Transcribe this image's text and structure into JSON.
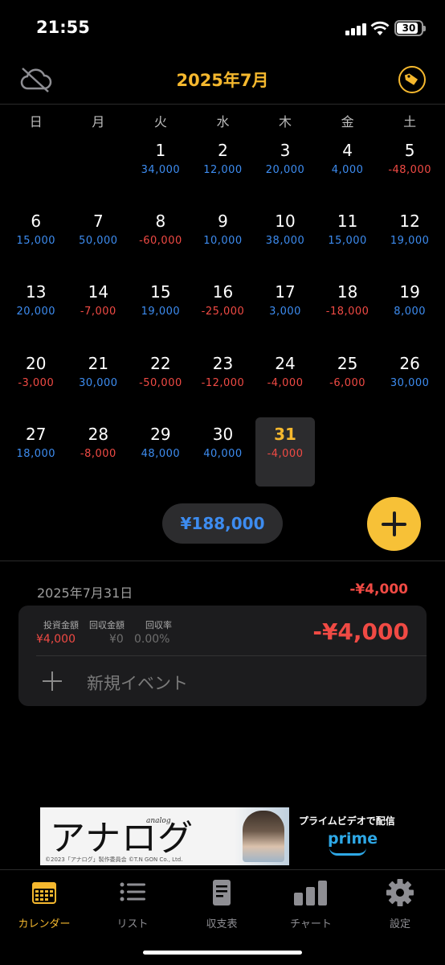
{
  "status_bar": {
    "time": "21:55",
    "battery": "30"
  },
  "header": {
    "title": "2025年7月",
    "cloud_icon": "cloud-off-icon",
    "tag_icon": "tag-icon"
  },
  "weekdays": [
    "日",
    "月",
    "火",
    "水",
    "木",
    "金",
    "土"
  ],
  "calendar": {
    "leading_blank_days": 2,
    "today": 31,
    "days": [
      {
        "day": "1",
        "amount": "34,000",
        "sign": "pos"
      },
      {
        "day": "2",
        "amount": "12,000",
        "sign": "pos"
      },
      {
        "day": "3",
        "amount": "20,000",
        "sign": "pos"
      },
      {
        "day": "4",
        "amount": "4,000",
        "sign": "pos"
      },
      {
        "day": "5",
        "amount": "-48,000",
        "sign": "neg"
      },
      {
        "day": "6",
        "amount": "15,000",
        "sign": "pos"
      },
      {
        "day": "7",
        "amount": "50,000",
        "sign": "pos"
      },
      {
        "day": "8",
        "amount": "-60,000",
        "sign": "neg"
      },
      {
        "day": "9",
        "amount": "10,000",
        "sign": "pos"
      },
      {
        "day": "10",
        "amount": "38,000",
        "sign": "pos"
      },
      {
        "day": "11",
        "amount": "15,000",
        "sign": "pos"
      },
      {
        "day": "12",
        "amount": "19,000",
        "sign": "pos"
      },
      {
        "day": "13",
        "amount": "20,000",
        "sign": "pos"
      },
      {
        "day": "14",
        "amount": "-7,000",
        "sign": "neg"
      },
      {
        "day": "15",
        "amount": "19,000",
        "sign": "pos"
      },
      {
        "day": "16",
        "amount": "-25,000",
        "sign": "neg"
      },
      {
        "day": "17",
        "amount": "3,000",
        "sign": "pos"
      },
      {
        "day": "18",
        "amount": "-18,000",
        "sign": "neg"
      },
      {
        "day": "19",
        "amount": "8,000",
        "sign": "pos"
      },
      {
        "day": "20",
        "amount": "-3,000",
        "sign": "neg"
      },
      {
        "day": "21",
        "amount": "30,000",
        "sign": "pos"
      },
      {
        "day": "22",
        "amount": "-50,000",
        "sign": "neg"
      },
      {
        "day": "23",
        "amount": "-12,000",
        "sign": "neg"
      },
      {
        "day": "24",
        "amount": "-4,000",
        "sign": "neg"
      },
      {
        "day": "25",
        "amount": "-6,000",
        "sign": "neg"
      },
      {
        "day": "26",
        "amount": "30,000",
        "sign": "pos"
      },
      {
        "day": "27",
        "amount": "18,000",
        "sign": "pos"
      },
      {
        "day": "28",
        "amount": "-8,000",
        "sign": "neg"
      },
      {
        "day": "29",
        "amount": "48,000",
        "sign": "pos"
      },
      {
        "day": "30",
        "amount": "40,000",
        "sign": "pos"
      },
      {
        "day": "31",
        "amount": "-4,000",
        "sign": "neg"
      }
    ]
  },
  "month_total": "¥188,000",
  "add_button_icon": "plus-icon",
  "detail": {
    "date": "2025年7月31日",
    "total": "-¥4,000",
    "card": {
      "invest_label": "投資金額",
      "invest_value": "¥4,000",
      "return_label": "回収金額",
      "return_value": "¥0",
      "rate_label": "回収率",
      "rate_value": "0.00%",
      "net": "-¥4,000",
      "new_event": "新規イベント"
    }
  },
  "ad": {
    "title": "アナログ",
    "subtitle": "analog",
    "copyright": "©2023「アナログ」製作委員会 ©T.N GON Co., Ltd.",
    "cta": "プライムビデオで配信",
    "brand": "prime"
  },
  "tabs": [
    {
      "label": "カレンダー",
      "icon": "calendar-icon",
      "active": true
    },
    {
      "label": "リスト",
      "icon": "list-icon",
      "active": false
    },
    {
      "label": "収支表",
      "icon": "document-icon",
      "active": false
    },
    {
      "label": "チャート",
      "icon": "bar-chart-icon",
      "active": false
    },
    {
      "label": "設定",
      "icon": "gear-icon",
      "active": false
    }
  ],
  "colors": {
    "accent": "#f5b82e",
    "positive": "#3d8cf0",
    "negative": "#f04a44"
  }
}
